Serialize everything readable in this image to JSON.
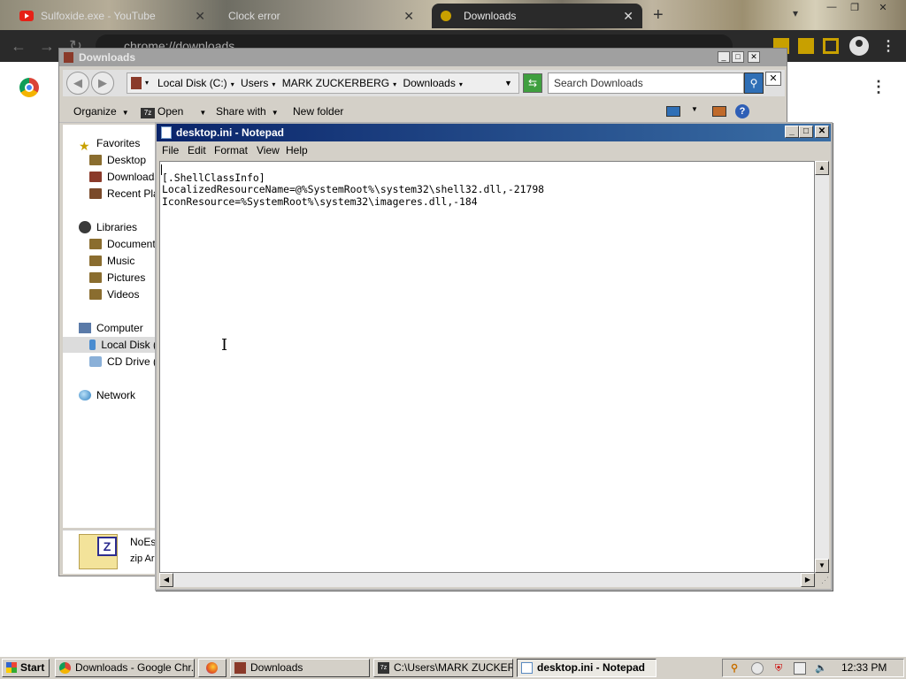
{
  "chrome": {
    "tabs": [
      {
        "label": "Sulfoxide.exe - YouTube"
      },
      {
        "label": "Clock error"
      },
      {
        "label": "Downloads"
      }
    ],
    "new_tab": "+",
    "omnibox_text": "chrome://downloads"
  },
  "explorer": {
    "title": "Downloads",
    "address": [
      "Local Disk (C:)",
      "Users",
      "MARK ZUCKERBERG",
      "Downloads"
    ],
    "search_placeholder": "Search Downloads",
    "commands": {
      "organize": "Organize",
      "open": "Open",
      "share": "Share with",
      "new_folder": "New folder"
    },
    "nav": {
      "favorites": "Favorites",
      "desktop": "Desktop",
      "downloads": "Downloads",
      "recent": "Recent Plac",
      "libraries": "Libraries",
      "documents": "Documents",
      "music": "Music",
      "pictures": "Pictures",
      "videos": "Videos",
      "computer": "Computer",
      "local_disk": "Local Disk (",
      "cd_drive": "CD Drive (E",
      "network": "Network"
    },
    "details": {
      "name": "NoEs",
      "type": "zip Ar"
    }
  },
  "notepad": {
    "title": "desktop.ini - Notepad",
    "menu": [
      "File",
      "Edit",
      "Format",
      "View",
      "Help"
    ],
    "content": "[.ShellClassInfo]\nLocalizedResourceName=@%SystemRoot%\\system32\\shell32.dll,-21798\nIconResource=%SystemRoot%\\system32\\imageres.dll,-184"
  },
  "taskbar": {
    "start": "Start",
    "tasks": [
      {
        "label": "Downloads - Google Chr..."
      },
      {
        "label": ""
      },
      {
        "label": "Downloads"
      },
      {
        "label": "C:\\Users\\MARK ZUCKER..."
      },
      {
        "label": "desktop.ini - Notepad"
      }
    ],
    "clock": "12:33 PM"
  },
  "colors": {
    "notepad_title_start": "#0a246a",
    "notepad_title_end": "#3a6ea5",
    "explorer_title_inactive": "#a0a0a0",
    "chrome_toolbar": "#2a2a2a"
  }
}
